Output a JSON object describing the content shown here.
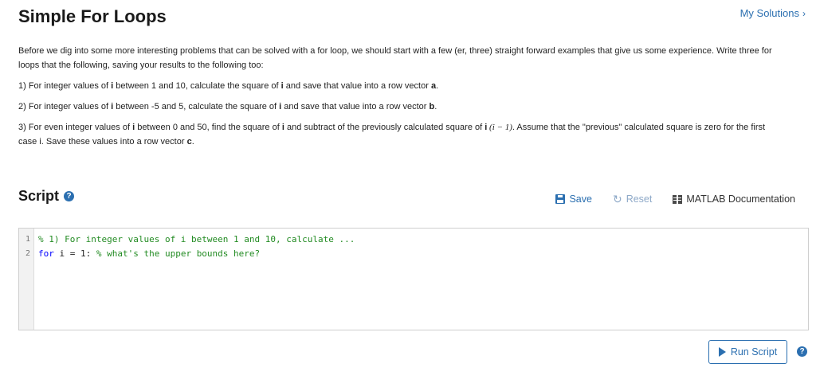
{
  "page": {
    "title": "Simple For Loops",
    "my_solutions": "My Solutions",
    "my_solutions_chevron": "›"
  },
  "description": {
    "intro": "Before we dig into some more interesting problems that can be solved with a for loop, we should start with a few (er, three) straight forward examples that give us some experience. Write three for loops that the following, saving your results to the following too:",
    "item1": {
      "p1": "1) For integer values of ",
      "var1": "i",
      "p2": " between 1 and 10, calculate the square of ",
      "var2": "i",
      "p3": " and save that value into a row vector ",
      "var3": "a",
      "p4": "."
    },
    "item2": {
      "p1": "2) For integer values of ",
      "var1": "i",
      "p2": " between -5 and 5, calculate the square of ",
      "var2": "i",
      "p3": " and save that value into a row vector ",
      "var3": "b",
      "p4": "."
    },
    "item3": {
      "p1": "3) For even integer values of ",
      "var1": "i",
      "p2": " between 0 and 50, find the square of ",
      "var2": "i",
      "p3": " and subtract of the previously calculated square of ",
      "var3": "i",
      "math": " (i − 1)",
      "p4": ". Assume that the \"previous\" calculated square is zero for the first case ",
      "var4": "i",
      "p5": ". Save these values into a row vector ",
      "var5": "c",
      "p6": "."
    }
  },
  "script": {
    "title": "Script",
    "help": "?",
    "save": "Save",
    "reset": "Reset",
    "reset_glyph": "↻",
    "docs": "MATLAB Documentation"
  },
  "editor": {
    "line_numbers": [
      "1",
      "2"
    ],
    "line1": {
      "comment": "% 1) For integer values of i between 1 and 10, calculate ..."
    },
    "line2": {
      "kw": "for",
      "code": " i = 1: ",
      "comment": "% what's the upper bounds here?"
    }
  },
  "run": {
    "label": "Run Script",
    "help": "?"
  },
  "colors": {
    "accent": "#2b6fb0",
    "comment": "#228b22",
    "keyword": "#0000ff"
  }
}
